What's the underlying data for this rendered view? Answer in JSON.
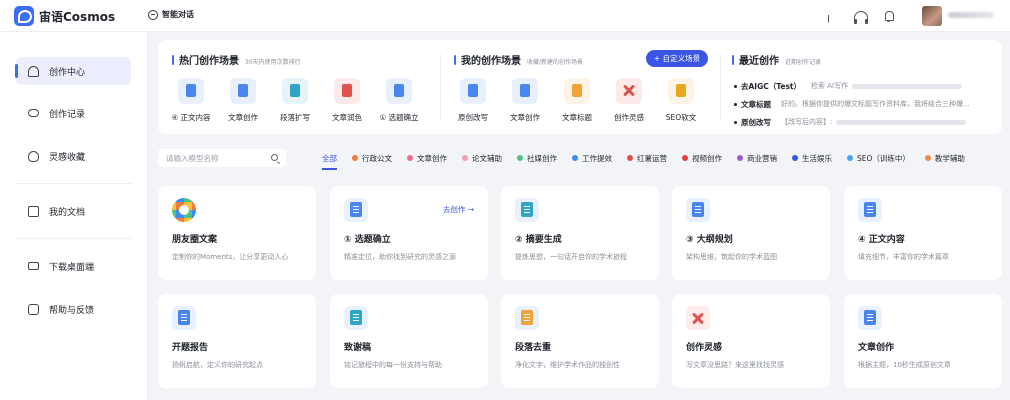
{
  "app": {
    "name": "宙语Cosmos"
  },
  "header": {
    "smart_chat": "智能对话"
  },
  "sidebar": {
    "items": [
      {
        "label": "创作中心",
        "icon": "home-icon",
        "active": true
      },
      {
        "label": "创作记录",
        "icon": "cloud-icon"
      },
      {
        "label": "灵感收藏",
        "icon": "bulb-icon"
      },
      {
        "label": "我的文档",
        "icon": "doc-icon"
      },
      {
        "label": "下载桌面端",
        "icon": "monitor-icon"
      },
      {
        "label": "帮助与反馈",
        "icon": "help-icon"
      }
    ]
  },
  "hot": {
    "title": "热门创作场景",
    "subtitle": "30天内使用次数排行",
    "items": [
      {
        "label": "④ 正文内容",
        "color": "#4a86f0"
      },
      {
        "label": "文章创作",
        "color": "#4a86f0"
      },
      {
        "label": "段落扩写",
        "color": "#2fa6c7"
      },
      {
        "label": "文章润色",
        "color": "#e0514e"
      },
      {
        "label": "① 选题确立",
        "color": "#4a86f0"
      }
    ]
  },
  "mine": {
    "title": "我的创作场景",
    "subtitle": "收藏/新建的创作场景",
    "add_button": "+ 自定义场景",
    "items": [
      {
        "label": "原创改写",
        "color": "#4a86f0"
      },
      {
        "label": "文章创作",
        "color": "#4a86f0"
      },
      {
        "label": "文章标题",
        "color": "#f0a23b"
      },
      {
        "label": "创作灵感",
        "color": "#e0514e"
      },
      {
        "label": "SEO软文",
        "color": "#e6a81e"
      }
    ]
  },
  "recent": {
    "title": "最近创作",
    "subtitle": "近期创作记录",
    "items": [
      {
        "key": "去AIGC（Test）",
        "value": "检索 AI写作"
      },
      {
        "key": "文章标题",
        "value": "好的。根据你提供的爆文标题写作资料库，我将结合三种爆..."
      },
      {
        "key": "原创改写",
        "value": "【改写后内容】:"
      }
    ]
  },
  "filters": {
    "search_placeholder": "请输入模型名称",
    "tabs": [
      {
        "label": "全部",
        "color": "",
        "active": true
      },
      {
        "label": "行政公文",
        "color": "#f07a3b"
      },
      {
        "label": "文章创作",
        "color": "#f06b8a"
      },
      {
        "label": "论文辅助",
        "color": "#f0a0b0"
      },
      {
        "label": "社媒创作",
        "color": "#52c08a"
      },
      {
        "label": "工作提效",
        "color": "#3b8cf5"
      },
      {
        "label": "红薯运营",
        "color": "#e0514e"
      },
      {
        "label": "视频创作",
        "color": "#e04040"
      },
      {
        "label": "商业营销",
        "color": "#9b59d0"
      },
      {
        "label": "生活娱乐",
        "color": "#3b56e6"
      },
      {
        "label": "SEO（训练中）",
        "color": "#4aa3f0"
      },
      {
        "label": "教学辅助",
        "color": "#f08a4a"
      }
    ]
  },
  "cards": [
    {
      "title": "朋友圈文案",
      "desc": "定制你的Moments，让分享更动人心",
      "icon": "ring"
    },
    {
      "title": "① 选题确立",
      "desc": "精准定位，助你找到研究的灵感之源",
      "icon": "docart",
      "action": "去创作 →"
    },
    {
      "title": "② 摘要生成",
      "desc": "提炼思想，一句话开启你的学术旅程",
      "icon": "docart teal"
    },
    {
      "title": "③ 大纲规划",
      "desc": "架构思维，筑起你的学术蓝图",
      "icon": "docart"
    },
    {
      "title": "④ 正文内容",
      "desc": "填充细节，丰富你的学术篇章",
      "icon": "docart"
    },
    {
      "title": "开题报告",
      "desc": "扬帆启航，定义你的研究起点",
      "icon": "docart"
    },
    {
      "title": "致谢稿",
      "desc": "铭记旅程中的每一份支持与帮助",
      "icon": "docart teal"
    },
    {
      "title": "段落去重",
      "desc": "净化文字，维护学术作品的独创性",
      "icon": "docart orange"
    },
    {
      "title": "创作灵感",
      "desc": "写文章没思路？来这里找找灵感",
      "icon": "xart"
    },
    {
      "title": "文章创作",
      "desc": "根据主题，10秒生成原创文章",
      "icon": "docart"
    }
  ]
}
